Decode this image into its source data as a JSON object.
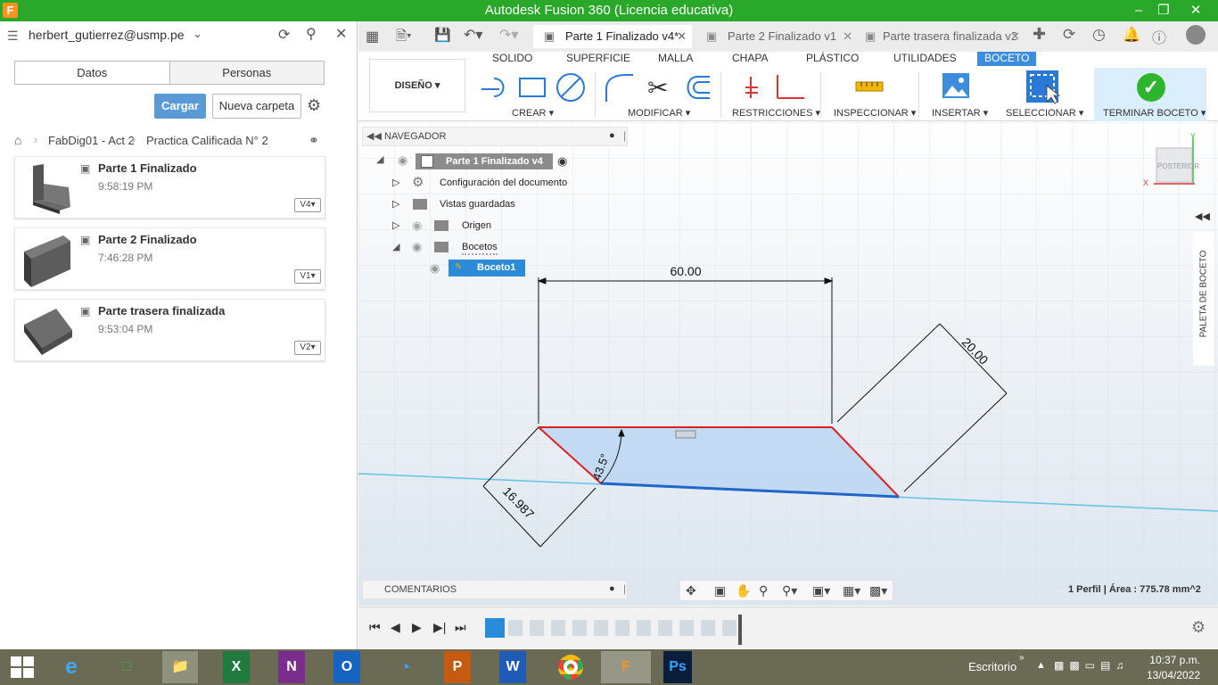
{
  "window": {
    "title": "Autodesk Fusion 360 (Licencia educativa)",
    "logo": "F"
  },
  "data_panel": {
    "user": "herbert_gutierrez@usmp.pe",
    "tabs": [
      "Datos",
      "Personas"
    ],
    "upload_label": "Cargar",
    "new_folder_label": "Nueva carpeta",
    "breadcrumb": [
      "FabDig01 - Act 2",
      "Practica Calificada N° 2"
    ],
    "files": [
      {
        "name": "Parte 1 Finalizado",
        "time": "9:58:19 PM",
        "version": "V4"
      },
      {
        "name": "Parte 2 Finalizado",
        "time": "7:46:28 PM",
        "version": "V1"
      },
      {
        "name": "Parte trasera finalizada",
        "time": "9:53:04 PM",
        "version": "V2"
      }
    ]
  },
  "doc_tabs": [
    {
      "label": "Parte 1 Finalizado v4*",
      "active": true
    },
    {
      "label": "Parte 2 Finalizado v1",
      "active": false
    },
    {
      "label": "Parte trasera finalizada v2",
      "active": false
    }
  ],
  "ribbon": {
    "workspace": "DISEÑO",
    "tabs": [
      "SOLIDO",
      "SUPERFICIE",
      "MALLA",
      "CHAPA",
      "PLÁSTICO",
      "UTILIDADES",
      "BOCETO"
    ],
    "active_tab": "BOCETO",
    "groups": [
      "CREAR",
      "MODIFICAR",
      "RESTRICCIONES",
      "INSPECCIONAR",
      "INSERTAR",
      "SELECCIONAR",
      "TERMINAR BOCETO"
    ]
  },
  "browser": {
    "title": "NAVEGADOR",
    "root": "Parte 1 Finalizado v4",
    "items": [
      "Configuración del documento",
      "Vistas guardadas",
      "Origen",
      "Bocetos"
    ],
    "sketch": "Boceto1"
  },
  "viewcube": {
    "label": "POSTERIOR",
    "x": "X",
    "y": "Y"
  },
  "palette_label": "PALETA DE BOCETO",
  "comments_label": "COMENTARIOS",
  "status": "1 Perfil | Área : 775.78 mm^2",
  "dimensions": {
    "width": "60.00",
    "height": "20.00",
    "angle": "43.5°",
    "diag": "16.987"
  },
  "taskbar": {
    "desktop_label": "Escritorio",
    "time": "10:37 p.m.",
    "date": "13/04/2022"
  },
  "colors": {
    "title_green": "#29a829",
    "accent_blue": "#3d8ddd",
    "sketch_fill": "#bcd6f5",
    "sketch_red": "#e02020",
    "sketch_blue": "#2166c8",
    "finish_green": "#2db52d"
  }
}
